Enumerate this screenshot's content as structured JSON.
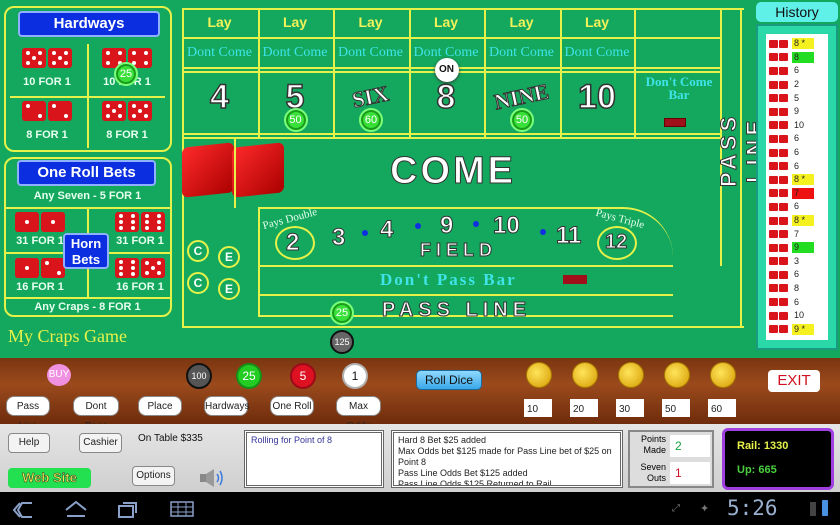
{
  "hardways": {
    "title": "Hardways",
    "bets": [
      {
        "label": "10 FOR 1",
        "dice": [
          5,
          5
        ]
      },
      {
        "label": "10 FOR 1",
        "dice": [
          4,
          4
        ],
        "chip": "25"
      },
      {
        "label": "8 FOR 1",
        "dice": [
          2,
          2
        ]
      },
      {
        "label": "8 FOR 1",
        "dice": [
          5,
          5
        ]
      }
    ]
  },
  "one_roll": {
    "title": "One Roll Bets",
    "any_seven": "Any Seven - 5 FOR 1",
    "horn_label": "Horn Bets",
    "bets": [
      {
        "label": "31 FOR 1",
        "dice": [
          1,
          1
        ]
      },
      {
        "label": "31 FOR 1",
        "dice": [
          6,
          6
        ]
      },
      {
        "label": "16 FOR 1",
        "dice": [
          1,
          2
        ]
      },
      {
        "label": "16 FOR 1",
        "dice": [
          6,
          5
        ]
      }
    ],
    "any_craps": "Any Craps - 8 FOR 1"
  },
  "game_title": "My Craps Game",
  "lay_label": "Lay",
  "dont_come_label": "Dont Come",
  "points": [
    {
      "label": "4",
      "chip": null
    },
    {
      "label": "5",
      "chip": "50"
    },
    {
      "label": "SIX",
      "chip": "60"
    },
    {
      "label": "8",
      "chip": null,
      "puck": "ON"
    },
    {
      "label": "NINE",
      "chip": "50"
    },
    {
      "label": "10",
      "chip": null
    }
  ],
  "dont_come_bar": "Don't Come Bar",
  "come_label": "COME",
  "field": {
    "pays_double": "Pays Double",
    "pays_triple": "Pays Triple",
    "numbers": [
      "2",
      "3",
      "4",
      "9",
      "10",
      "11",
      "12"
    ],
    "label": "FIELD"
  },
  "dont_pass_bar": "Don't Pass Bar",
  "pass_line": "PASS LINE",
  "pass_line_vertical": "PASS LINE",
  "pass_line_chip": "25",
  "odds_chip": "125",
  "ce": [
    "C",
    "E"
  ],
  "history": {
    "title": "History",
    "rolls": [
      {
        "dice": [
          4,
          4
        ],
        "value": "8",
        "mark": "*",
        "highlight": "yellow"
      },
      {
        "dice": [
          6,
          2
        ],
        "value": "8",
        "mark": "",
        "highlight": "green"
      },
      {
        "dice": [
          5,
          1
        ],
        "value": "6",
        "mark": "",
        "highlight": ""
      },
      {
        "dice": [
          1,
          1
        ],
        "value": "2",
        "mark": "",
        "highlight": ""
      },
      {
        "dice": [
          3,
          2
        ],
        "value": "5",
        "mark": "",
        "highlight": ""
      },
      {
        "dice": [
          3,
          6
        ],
        "value": "9",
        "mark": "",
        "highlight": ""
      },
      {
        "dice": [
          4,
          6
        ],
        "value": "10",
        "mark": "",
        "highlight": ""
      },
      {
        "dice": [
          4,
          2
        ],
        "value": "6",
        "mark": "",
        "highlight": ""
      },
      {
        "dice": [
          2,
          4
        ],
        "value": "6",
        "mark": "",
        "highlight": ""
      },
      {
        "dice": [
          5,
          1
        ],
        "value": "6",
        "mark": "",
        "highlight": ""
      },
      {
        "dice": [
          4,
          4
        ],
        "value": "8",
        "mark": "*",
        "highlight": "yellow"
      },
      {
        "dice": [
          5,
          2
        ],
        "value": "7",
        "mark": "",
        "highlight": "red"
      },
      {
        "dice": [
          4,
          2
        ],
        "value": "6",
        "mark": "",
        "highlight": ""
      },
      {
        "dice": [
          5,
          3
        ],
        "value": "8",
        "mark": "*",
        "highlight": "yellow"
      },
      {
        "dice": [
          3,
          4
        ],
        "value": "7",
        "mark": "",
        "highlight": ""
      },
      {
        "dice": [
          3,
          6
        ],
        "value": "9",
        "mark": "",
        "highlight": "green"
      },
      {
        "dice": [
          1,
          2
        ],
        "value": "3",
        "mark": "",
        "highlight": ""
      },
      {
        "dice": [
          5,
          1
        ],
        "value": "6",
        "mark": "",
        "highlight": ""
      },
      {
        "dice": [
          5,
          3
        ],
        "value": "8",
        "mark": "",
        "highlight": ""
      },
      {
        "dice": [
          5,
          1
        ],
        "value": "6",
        "mark": "",
        "highlight": ""
      },
      {
        "dice": [
          4,
          6
        ],
        "value": "10",
        "mark": "",
        "highlight": ""
      },
      {
        "dice": [
          3,
          6
        ],
        "value": "9",
        "mark": "*",
        "highlight": "yellow"
      }
    ]
  },
  "rail": {
    "buy_label": "BUY",
    "chips": [
      {
        "value": "100",
        "color": "#555555"
      },
      {
        "value": "25",
        "color": "#22cc22"
      },
      {
        "value": "5",
        "color": "#dd1122"
      },
      {
        "value": "1",
        "color": "#ffffff"
      }
    ],
    "bet_buttons": [
      "Pass Line",
      "Dont Pass",
      "Place",
      "Hardways",
      "One Roll",
      "Max Odds"
    ],
    "roll_dice": "Roll Dice",
    "coin_values": [
      "10",
      "20",
      "30",
      "50",
      "60"
    ],
    "exit": "EXIT"
  },
  "panel": {
    "help": "Help",
    "cashier": "Cashier",
    "on_table": "On Table $335",
    "website": "Web Site",
    "options": "Options",
    "status_msg": "Rolling for Point of 8",
    "log": [
      "Hard 8 Bet $25 added",
      "Max Odds bet $125 made for Pass Line bet of $25 on Point 8",
      "Pass Line Odds Bet $125 added",
      "Pass Line Odds $125 Returned to Rail"
    ],
    "points_made_label": "Points Made",
    "points_made": "2",
    "seven_outs_label": "Seven Outs",
    "seven_outs": "1",
    "rail_label": "Rail: 1330",
    "up_label": "Up: 665"
  },
  "statusbar": {
    "time": "5:26"
  }
}
